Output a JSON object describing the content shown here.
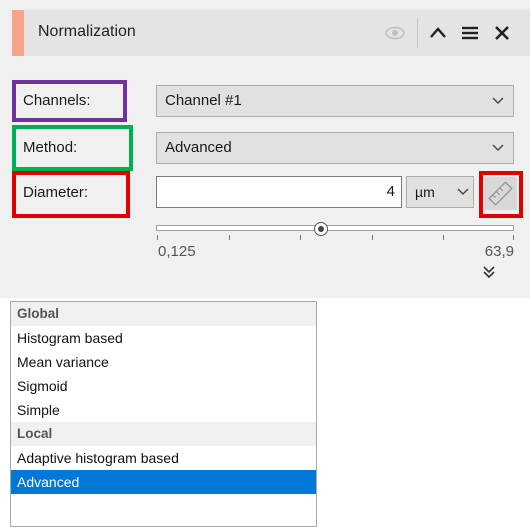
{
  "header": {
    "title": "Normalization",
    "accent_color": "#f6a58a",
    "icons": [
      "eye-icon",
      "chevron-up-icon",
      "menu-icon",
      "close-icon"
    ]
  },
  "labels": {
    "channels": "Channels:",
    "method": "Method:",
    "diameter": "Diameter:"
  },
  "channels_select": {
    "value": "Channel #1"
  },
  "method_select": {
    "value": "Advanced"
  },
  "diameter": {
    "value": "4",
    "unit": "µm",
    "slider_min": "0,125",
    "slider_max": "63,9",
    "slider_position": 0.45
  },
  "annotation_colors": {
    "channels": "#7030a0",
    "method": "#00b050",
    "diameter": "#e00000",
    "ruler": "#e00000"
  },
  "dropdown": {
    "groups": [
      {
        "name": "Global",
        "options": [
          "Histogram based",
          "Mean variance",
          "Sigmoid",
          "Simple"
        ]
      },
      {
        "name": "Local",
        "options": [
          "Adaptive histogram based",
          "Advanced"
        ]
      }
    ],
    "selected": "Advanced",
    "selected_color": "#0078d7"
  }
}
